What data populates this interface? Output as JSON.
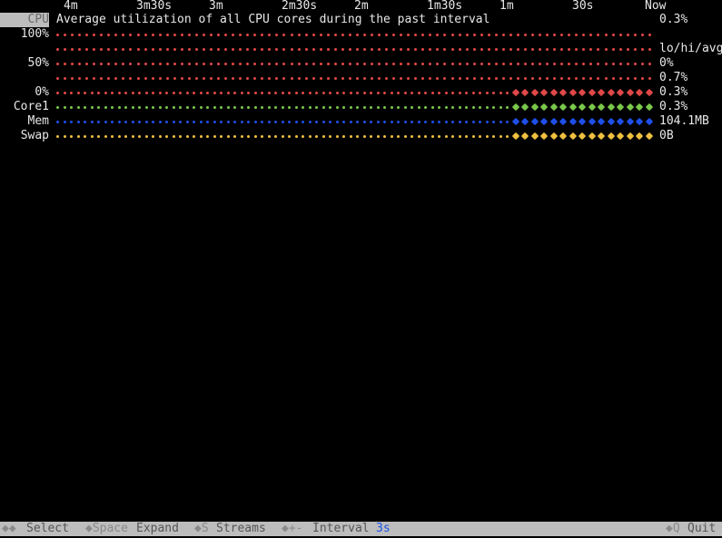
{
  "timeline": {
    "labels": [
      {
        "text": "4m",
        "col": 70
      },
      {
        "text": "3m30s",
        "col": 150
      },
      {
        "text": "3m",
        "col": 230
      },
      {
        "text": "2m30s",
        "col": 310
      },
      {
        "text": "2m",
        "col": 390
      },
      {
        "text": "1m30s",
        "col": 470
      },
      {
        "text": "1m",
        "col": 550
      },
      {
        "text": "30s",
        "col": 630
      },
      {
        "text": "Now",
        "col": 710
      }
    ]
  },
  "header": {
    "selected_label": "CPU",
    "description": "Average utilization of all CPU cores during the past interval",
    "current_value": "0.3%"
  },
  "cpu_graph": {
    "axis": [
      "100%",
      "50%",
      "0%"
    ],
    "side_values": [
      "lo/hi/avg",
      "0%",
      "0.7%",
      "0.3%"
    ]
  },
  "streams": [
    {
      "id": "core1",
      "label": "Core1",
      "value": "0.3%",
      "color": "#7ac84a"
    },
    {
      "id": "mem",
      "label": "Mem",
      "value": "104.1MB",
      "color": "#1f4fe8"
    },
    {
      "id": "swap",
      "label": "Swap",
      "value": "0B",
      "color": "#f0c040"
    }
  ],
  "cpu_color": "#e04848",
  "statusbar": {
    "select_key": "◆◆",
    "select_label": "Select",
    "expand_key": "◆Space",
    "expand_label": "Expand",
    "streams_key": "◆S",
    "streams_label": "Streams",
    "interval_key": "◆+-",
    "interval_label": "Interval",
    "interval_value": "3s",
    "quit_key": "◆Q",
    "quit_label": "Quit"
  }
}
